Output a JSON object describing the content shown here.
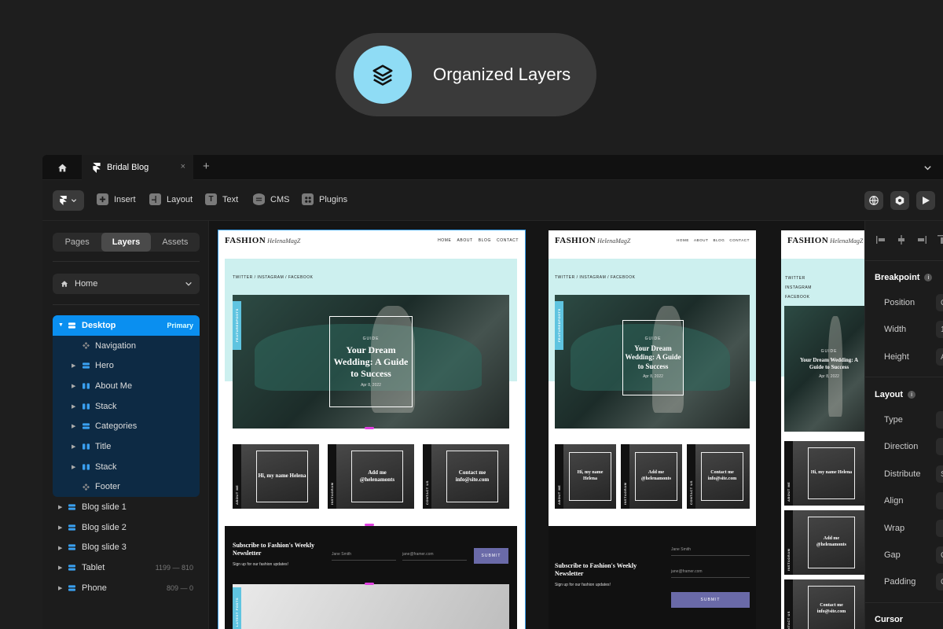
{
  "hero": {
    "title": "Organized Layers"
  },
  "tabs": {
    "file_title": "Bridal Blog",
    "close": "×",
    "add": "+"
  },
  "toolbar": {
    "insert": "Insert",
    "layout": "Layout",
    "text": "Text",
    "cms": "CMS",
    "plugins": "Plugins"
  },
  "sidebar": {
    "segments": [
      "Pages",
      "Layers",
      "Assets"
    ],
    "active_segment": "Layers",
    "page": "Home",
    "layers": [
      {
        "name": "Desktop",
        "meta": "Primary"
      },
      {
        "name": "Navigation"
      },
      {
        "name": "Hero"
      },
      {
        "name": "About Me"
      },
      {
        "name": "Stack"
      },
      {
        "name": "Categories"
      },
      {
        "name": "Title"
      },
      {
        "name": "Stack"
      },
      {
        "name": "Footer"
      },
      {
        "name": "Blog slide 1"
      },
      {
        "name": "Blog slide 2"
      },
      {
        "name": "Blog slide 3"
      },
      {
        "name": "Tablet",
        "meta": "1199 — 810"
      },
      {
        "name": "Phone",
        "meta": "809 — 0"
      }
    ]
  },
  "site": {
    "logo": "FASHION",
    "logo_script": "HelenaMagZ",
    "menu": [
      "HOME",
      "ABOUT",
      "BLOG",
      "CONTACT"
    ],
    "social": "TWITTER / INSTAGRAM / FACEBOOK",
    "social_twitter": "TWITTER",
    "social_instagram": "INSTAGRAM",
    "social_facebook": "FACEBOOK",
    "featured_tab": "FEATUREDPOSTS",
    "card_category": "GUIDE",
    "card_title": "Your Dream Wedding: A Guide to Success",
    "card_date": "Apr 8, 2022",
    "tiles": [
      {
        "strip": "ABOUT ME",
        "text": "Hi, my name Helena"
      },
      {
        "strip": "INSTAGRAM",
        "text": "Add me @helenamonts"
      },
      {
        "strip": "CONTACT US",
        "text": "Contact me info@site.com"
      }
    ],
    "newsletter_title": "Subscribe to Fashion's Weekly Newsletter",
    "newsletter_sub": "Sign up for our fashion updates!",
    "name_placeholder": "Jane Smith",
    "email_placeholder": "jane@framer.com",
    "submit": "SUBMIT",
    "latest_tab": "LATEST POSTS"
  },
  "right_panel": {
    "breakpoint": "Breakpoint",
    "position": "Position",
    "width": "Width",
    "height": "Height",
    "layout": "Layout",
    "type": "Type",
    "direction": "Direction",
    "distribute": "Distribute",
    "align": "Align",
    "wrap": "Wrap",
    "gap": "Gap",
    "padding": "Padding",
    "cursor": "Cursor",
    "info": "i",
    "val_position": "C",
    "val_width": "1",
    "val_height": "A",
    "val_distribute": "S",
    "val_gap": "C",
    "val_padding": "C"
  },
  "colors": {
    "accent": "#0a8ff0",
    "hero_icon": "#8fdcf5",
    "teal": "#cdf0ef",
    "submit": "#6a6aa8"
  }
}
